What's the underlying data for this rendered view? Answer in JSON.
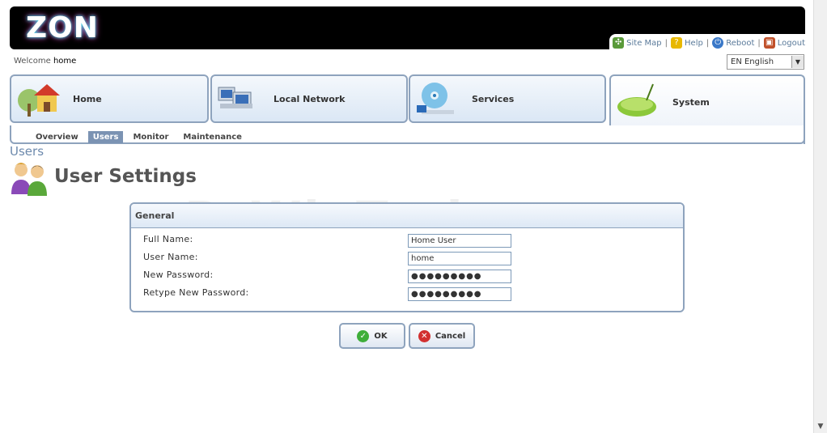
{
  "brand": {
    "logo_text": "ZON"
  },
  "top_links": [
    {
      "label": "Site Map",
      "icon": "sitemap-icon"
    },
    {
      "label": "Help",
      "icon": "help-icon"
    },
    {
      "label": "Reboot",
      "icon": "power-icon"
    },
    {
      "label": "Logout",
      "icon": "logout-icon"
    }
  ],
  "welcome": {
    "prefix": "Welcome",
    "user": "home"
  },
  "language": {
    "selected": "EN English"
  },
  "nav": {
    "tabs": [
      {
        "label": "Home",
        "icon": "home-icon"
      },
      {
        "label": "Local Network",
        "icon": "computers-icon"
      },
      {
        "label": "Services",
        "icon": "disc-icon"
      },
      {
        "label": "System",
        "icon": "router-icon",
        "active": true
      }
    ],
    "subtabs": [
      {
        "label": "Overview"
      },
      {
        "label": "Users",
        "active": true
      },
      {
        "label": "Monitor"
      },
      {
        "label": "Maintenance"
      }
    ]
  },
  "page": {
    "section": "Users",
    "title": "User Settings"
  },
  "watermark": "PcWinTech.com",
  "form": {
    "legend": "General",
    "fields": [
      {
        "label": "Full Name:",
        "value": "Home User"
      },
      {
        "label": "User Name:",
        "value": "home"
      },
      {
        "label": "New Password:",
        "value": "●●●●●●●●●"
      },
      {
        "label": "Retype New Password:",
        "value": "●●●●●●●●●"
      }
    ]
  },
  "buttons": {
    "ok": "OK",
    "cancel": "Cancel"
  },
  "colors": {
    "accent": "#7b93b3",
    "border": "#8ea3bd",
    "header_bg": "#000000"
  }
}
